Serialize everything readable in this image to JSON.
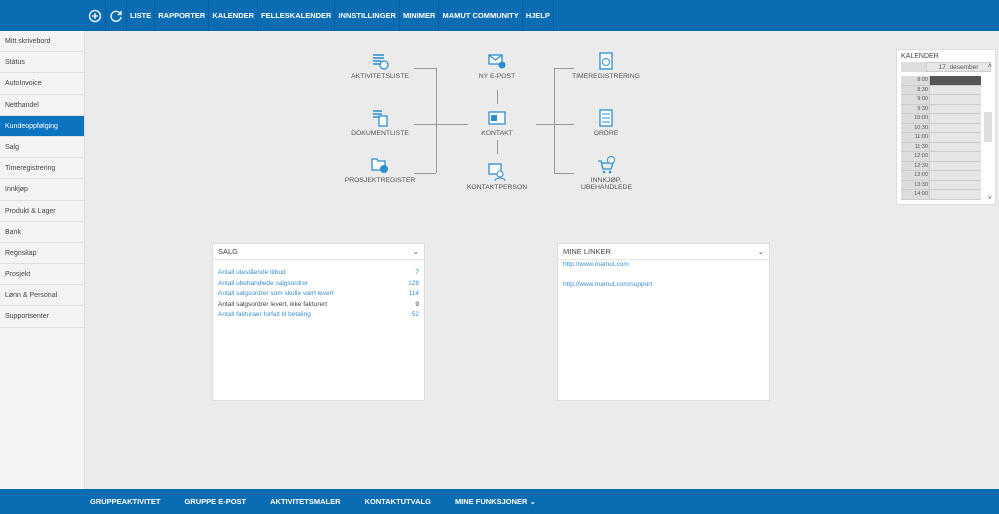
{
  "topnav": {
    "items": [
      "LISTE",
      "RAPPORTER",
      "KALENDER",
      "FELLESKALENDER",
      "INNSTILLINGER",
      "MINIMER",
      "MAMUT COMMUNITY",
      "HJELP"
    ]
  },
  "sidebar": {
    "items": [
      "Mitt skrivebord",
      "Status",
      "AutoInvoice",
      "Netthandel",
      "Kundeoppfølging",
      "Salg",
      "Timeregistrering",
      "Innkjøp",
      "Produkt & Lager",
      "Bank",
      "Regnskap",
      "Prosjekt",
      "Lønn & Personal",
      "Supportsenter"
    ],
    "active": "Kundeoppfølging"
  },
  "diagram": {
    "aktivitetsliste": "AKTIVITETSLISTE",
    "dokumentliste": "DOKUMENTLISTE",
    "prosjektregister": "PROSJEKTREGISTER",
    "ny_epost": "NY E-POST",
    "kontakt": "KONTAKT",
    "kontaktperson": "KONTAKTPERSON",
    "timeregistrering": "TIMEREGISTRERING",
    "ordre": "ORDRE",
    "innkjop": "INNKJØP, UBEHANDLEDE"
  },
  "calendar": {
    "title": "KALENDER",
    "date": "17. desember",
    "times": [
      "8:00",
      "8:30",
      "9:00",
      "9:30",
      "10:00",
      "10:30",
      "11:00",
      "11:30",
      "12:00",
      "12:30",
      "13:00",
      "13:30",
      "14:00"
    ]
  },
  "salg": {
    "title": "SALG",
    "rows": [
      {
        "label": "Antall utestående tilbud",
        "value": "7"
      },
      {
        "label": "Antall ubehandlede salgsordrer",
        "value": "128"
      },
      {
        "label": "Antall salgsordrer som skulle vært levert",
        "value": "114"
      },
      {
        "label": "Antall salgsordrer levert, ikke fakturert",
        "value": "9"
      },
      {
        "label": "Antall fakturaer forfalt til betaling",
        "value": "52"
      }
    ]
  },
  "links": {
    "title": "MINE LINKER",
    "items": [
      "http://www.mamut.com",
      "http://www.mamut.com/support"
    ]
  },
  "bottombar": {
    "items": [
      "GRUPPEAKTIVITET",
      "GRUPPE E-POST",
      "AKTIVITETSMALER",
      "KONTAKTUTVALG",
      "MINE FUNKSJONER"
    ]
  }
}
